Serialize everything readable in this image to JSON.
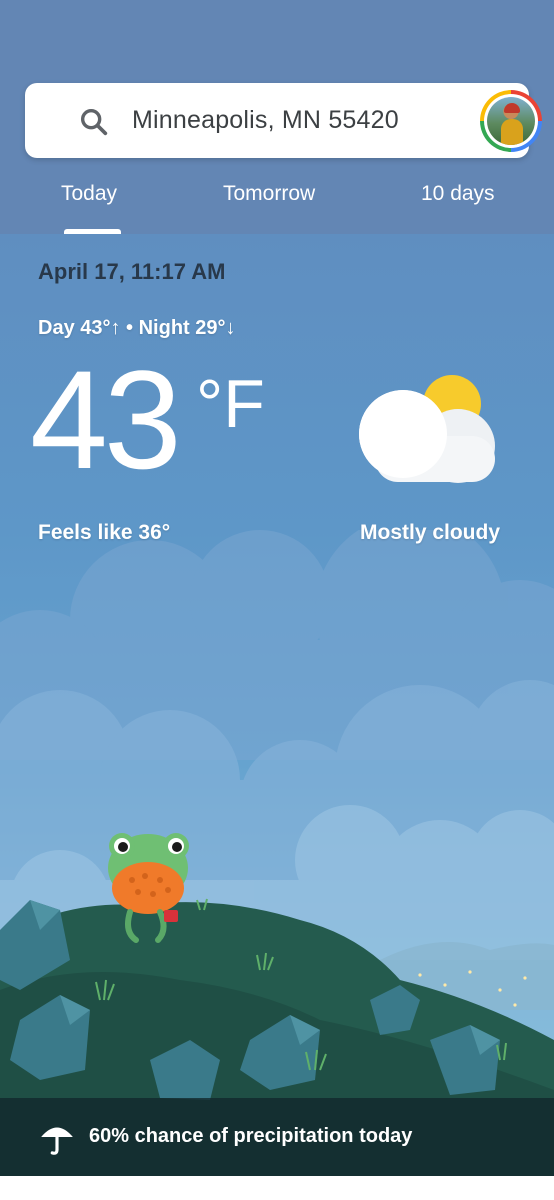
{
  "search": {
    "location": "Minneapolis, MN 55420",
    "icon": "search-icon"
  },
  "tabs": [
    {
      "label": "Today",
      "selected": true
    },
    {
      "label": "Tomorrow",
      "selected": false
    },
    {
      "label": "10 days",
      "selected": false
    }
  ],
  "weather": {
    "datetime": "April 17, 11:17 AM",
    "day_night": "Day 43°↑ • Night 29°↓",
    "temperature": "43",
    "unit": "°F",
    "feels_like": "Feels like 36°",
    "condition": "Mostly cloudy",
    "condition_icon": "partly-cloudy-icon"
  },
  "precipitation": {
    "text": "60% chance of precipitation today",
    "icon": "umbrella-icon"
  },
  "colors": {
    "header": "#6386b4",
    "sky_top": "#6288b8",
    "sun": "#f7cb2c",
    "bar": "#12262c"
  }
}
